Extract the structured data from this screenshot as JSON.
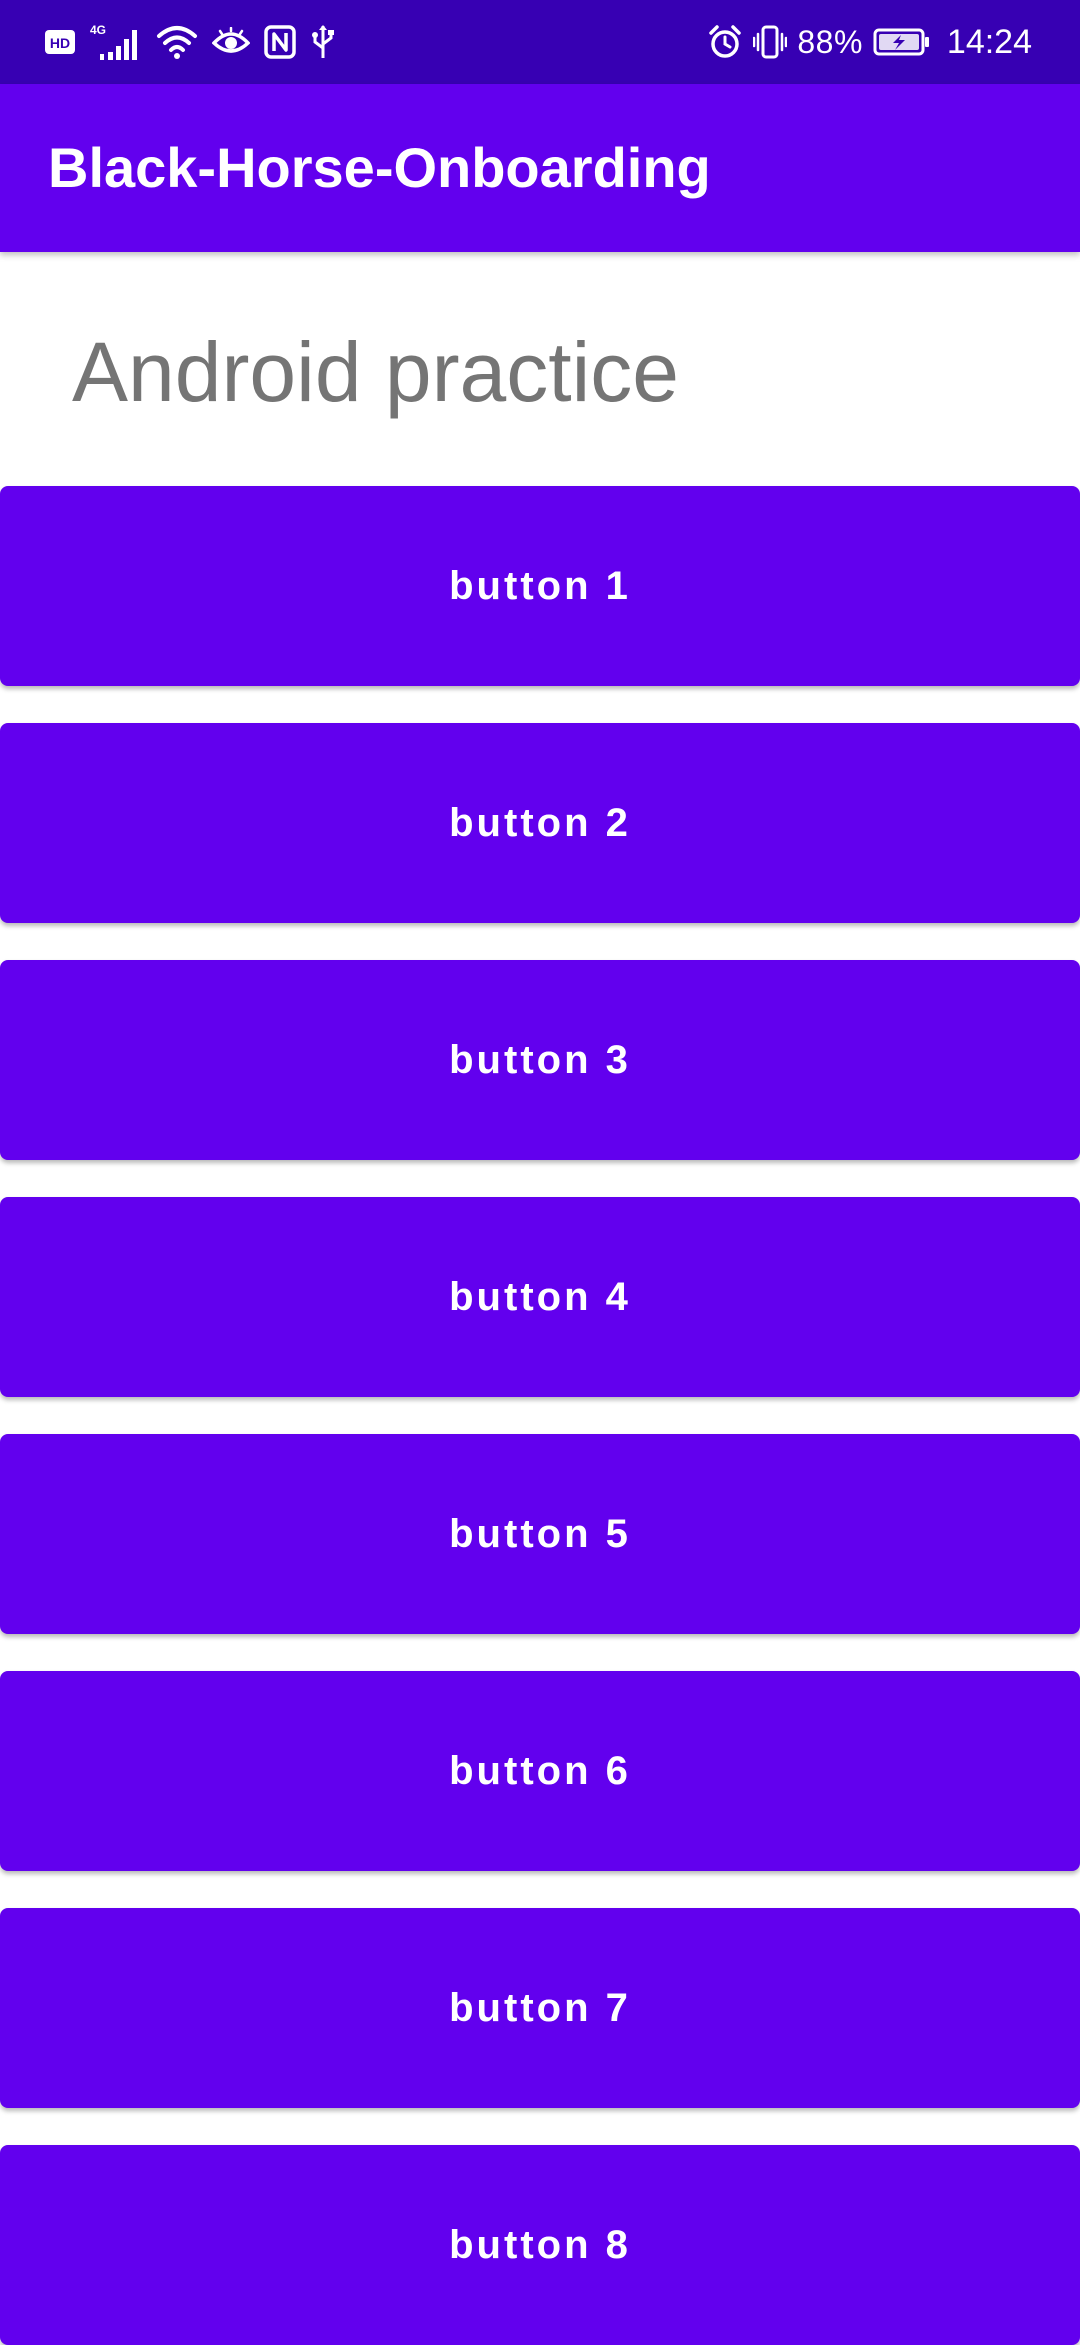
{
  "status_bar": {
    "icons": [
      "hd-icon",
      "4g-signal-icon",
      "wifi-icon",
      "eye-comfort-icon",
      "nfc-icon",
      "usb-icon",
      "alarm-icon",
      "vibrate-icon",
      "battery-charging-icon"
    ],
    "battery_percent": "88%",
    "time": "14:24",
    "network_label": "4G",
    "hd_label": "HD"
  },
  "app_bar": {
    "title": "Black-Horse-Onboarding",
    "color": "#6200EE"
  },
  "main": {
    "heading": "Android practice",
    "buttons": [
      {
        "label": "button 1"
      },
      {
        "label": "button 2"
      },
      {
        "label": "button 3"
      },
      {
        "label": "button 4"
      },
      {
        "label": "button 5"
      },
      {
        "label": "button 6"
      },
      {
        "label": "button 7"
      },
      {
        "label": "button 8"
      }
    ]
  },
  "colors": {
    "status_bar": "#3700B3",
    "primary": "#6200EE",
    "heading_text": "#757575",
    "on_primary": "#FFFFFF"
  }
}
